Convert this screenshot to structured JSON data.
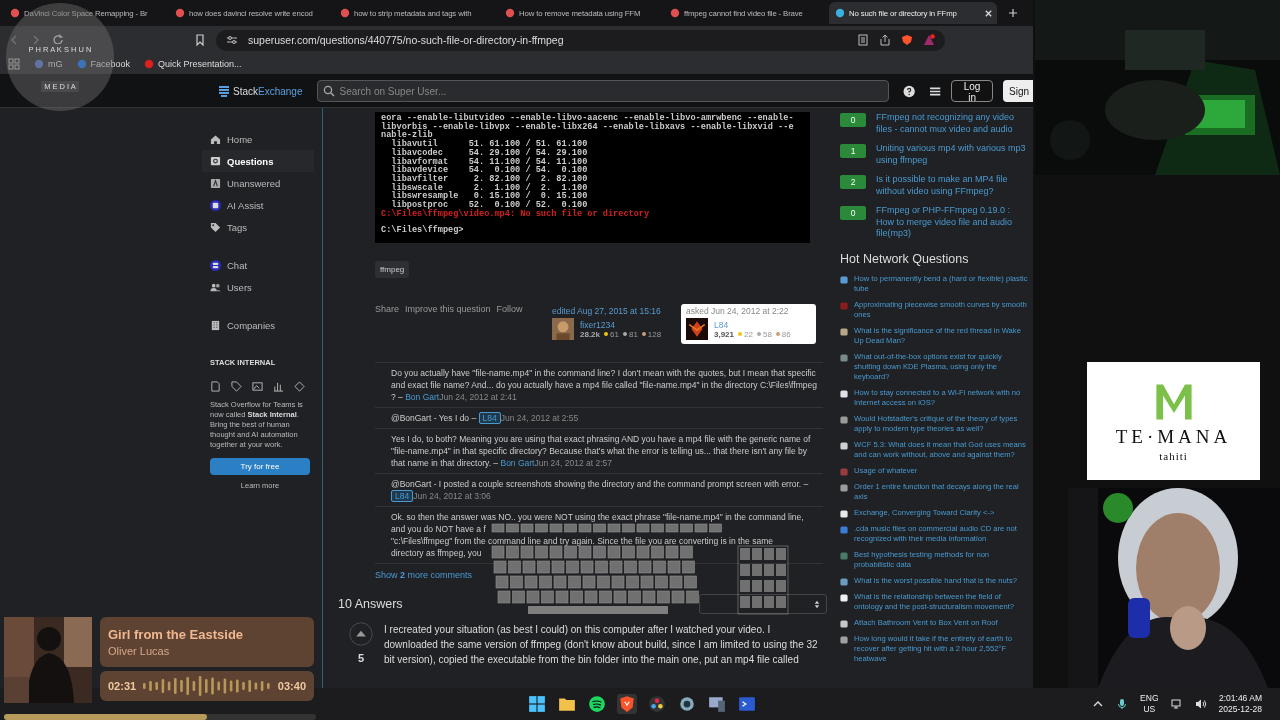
{
  "browser": {
    "tabs": [
      {
        "title": "DaVinci Color Space Remapping - Br",
        "selected": false
      },
      {
        "title": "how does davinci resolve write encod",
        "selected": false
      },
      {
        "title": "how to strip metadata and tags with",
        "selected": false
      },
      {
        "title": "How to remove metadata using FFM",
        "selected": false
      },
      {
        "title": "ffmpeg cannot find video file - Brave",
        "selected": false
      },
      {
        "title": "No such file or directory in FFmp",
        "selected": true
      }
    ],
    "address": "superuser.com/questions/440775/no-such-file-or-directory-in-ffmpeg",
    "bookmarks": [
      "mG",
      "Facebook",
      "Quick Presentation..."
    ]
  },
  "stream_logo": {
    "top": "P H R A K S H U N",
    "bottom": "M E D I A"
  },
  "site_header": {
    "logo_a": "Stack",
    "logo_b": "Exchange",
    "search_placeholder": "Search on Super User...",
    "login": "Log in",
    "signup": "Sign"
  },
  "nav": {
    "items": [
      {
        "label": "Home",
        "selected": false
      },
      {
        "label": "Questions",
        "selected": true
      },
      {
        "label": "Unanswered",
        "selected": false
      },
      {
        "label": "AI Assist",
        "selected": false
      },
      {
        "label": "Tags",
        "selected": false
      },
      {
        "label": "Chat",
        "selected": false
      },
      {
        "label": "Users",
        "selected": false
      },
      {
        "label": "Companies",
        "selected": false
      }
    ],
    "section_title": "STACK INTERNAL",
    "promo": "Stack Overflow for Teams is now called **Stack Internal**. Bring the best of human thought and AI automation together at your work.",
    "try_button": "Try for free",
    "learn_more": "Learn more"
  },
  "question": {
    "terminal": [
      {
        "kind": "normal",
        "text": "eora --enable-libutvideo --enable-libvo-aacenc --enable-libvo-amrwbenc --enable-"
      },
      {
        "kind": "normal",
        "text": "libvorbis --enable-libvpx --enable-libx264 --enable-libxavs --enable-libxvid --e"
      },
      {
        "kind": "normal",
        "text": "nable-zlib"
      },
      {
        "kind": "normal",
        "text": "  libavutil      51. 61.100 / 51. 61.100"
      },
      {
        "kind": "normal",
        "text": "  libavcodec     54. 29.100 / 54. 29.100"
      },
      {
        "kind": "normal",
        "text": "  libavformat    54. 11.100 / 54. 11.100"
      },
      {
        "kind": "normal",
        "text": "  libavdevice    54.  0.100 / 54.  0.100"
      },
      {
        "kind": "normal",
        "text": "  libavfilter     2. 82.100 /  2. 82.100"
      },
      {
        "kind": "normal",
        "text": "  libswscale      2.  1.100 /  2.  1.100"
      },
      {
        "kind": "normal",
        "text": "  libswresample   0. 15.100 /  0. 15.100"
      },
      {
        "kind": "normal",
        "text": "  libpostproc    52.  0.100 / 52.  0.100"
      },
      {
        "kind": "error",
        "text": "C:\\Files\\ffmpeg\\video.mp4: No such file or directory"
      },
      {
        "kind": "prompt",
        "text": "C:\\Files\\ffmpeg>"
      }
    ],
    "tags": [
      "ffmpeg"
    ],
    "actions": [
      "Share",
      "Improve this question",
      "Follow"
    ],
    "edited": {
      "label": "edited Aug 27, 2015 at 15:16",
      "user": "fixer1234",
      "rep": "28.2k",
      "gold": "61",
      "silver": "81",
      "bronze": "128"
    },
    "asked": {
      "label": "asked Jun 24, 2012 at 2:22",
      "user": "L84",
      "rep": "3,921",
      "gold": "22",
      "silver": "58",
      "bronze": "86"
    }
  },
  "comments": [
    {
      "lines": [
        "Do you actually have \"file-name.mp4\" in the command line? I don't mean with the quotes, but I mean that specific and exact file name? And... do you actually have a mp4 file called \"file-name.mp4\" in the directory C:\\Files\\ffmpeg ? –"
      ],
      "user": "Bon Gart",
      "op": false,
      "date": "Jun 24, 2012 at 2:41"
    },
    {
      "lines": [
        "@BonGart - Yes I do –"
      ],
      "user": "L84",
      "op": true,
      "date": "Jun 24, 2012 at 2:55"
    },
    {
      "lines": [
        "Yes I do, to both? Meaning you are using that exact phrasing AND you have a mp4 file with the generic name of \"file-name.mp4\" in that specific directory? Because that's what the error is telling us... that there isn't any file by that name in that directory. –"
      ],
      "user": "Bon Gart",
      "op": false,
      "date": "Jun 24, 2012 at 2:57"
    },
    {
      "lines": [
        "@BonGart - I posted a couple screenshots showing the directory and the command prompt screen with error. –"
      ],
      "user": "L84",
      "op": true,
      "date": "Jun 24, 2012 at 3:06"
    },
    {
      "lines": [
        "Ok. so then the answer was NO.. you were NOT using the exact phrase \"file-name.mp4\" in the command line,",
        "and you do NOT have a f",
        "\"c:\\Files\\ffmpeg\" from the command line and try again. Since the file you are converting is in the same",
        "directory as ffmpeg, you"
      ]
    }
  ],
  "show_more": "Show **2** more comments",
  "answers": {
    "title": "10 Answers",
    "score": "5",
    "text": "I recreated your situation (as best I could) on this computer after I watched your video. I downloaded the same version of ffmpeg (don't know about build, since I am limited to using the 32 bit version), copied the executable from the bin folder into the main one, put an mp4 file called"
  },
  "related": [
    {
      "score": "0",
      "title": "FFmpeg not recognizing any video files - cannot mux video and audio"
    },
    {
      "score": "1",
      "title": "Uniting various mp4 with various mp3 using ffmpeg"
    },
    {
      "score": "2",
      "title": "Is it possible to make an MP4 file without video using FFmpeg?"
    },
    {
      "score": "0",
      "title": "FFmpeg or PHP-FFmpeg 0.19.0 : How to merge video file and audio file(mp3)"
    }
  ],
  "hot_title": "Hot Network Questions",
  "hot": [
    {
      "title": "How to permanently bend a (hard or flexible) plastic tube",
      "color": "#5b9bd5"
    },
    {
      "title": "Approximating piecewise smooth curves by smooth ones",
      "color": "#8b1c1c"
    },
    {
      "title": "What is the significance of the red thread in Wake Up Dead Man?",
      "color": "#b8a88a"
    },
    {
      "title": "What out-of-the-box options exist for quickly shutting down KDE Plasma, using only the keyboard?",
      "color": "#7a8a8a"
    },
    {
      "title": "How to stay connected to a Wi-Fi network with no Internet access on iOS?",
      "color": "#dde3e8"
    },
    {
      "title": "Would Hofstadter's critique of the theory of types apply to modern type theories as well?",
      "color": "#9a9a9a"
    },
    {
      "title": "WCF 5.3: What does it mean that God uses means and can work without, above and against them?",
      "color": "#d0d0d0"
    },
    {
      "title": "Usage of whatever",
      "color": "#9c3b3b"
    },
    {
      "title": "Order 1 entire function that decays along the real axis",
      "color": "#9b9b9b"
    },
    {
      "title": "Exchange, Converging Toward Clarity <->",
      "color": "#e8e8e8"
    },
    {
      "title": ".cda music files on commercial audio CD are not recognized with their media information",
      "color": "#3a7bd5"
    },
    {
      "title": "Best hypothesis testing methods for non probabilistic data",
      "color": "#4a7a6a"
    },
    {
      "title": "What is the worst possible hand that is the nuts?",
      "color": "#6a9bc0"
    },
    {
      "title": "What is the relationship between the field of ontology and the post-structuralism movement?",
      "color": "#f0f0f0"
    },
    {
      "title": "Attach Bathroom Vent to Box Vent on Roof",
      "color": "#c8c8c8"
    },
    {
      "title": "How long would it take if the entirety of earth to recover after getting hit with a 2 hour 2,552°F heatwave",
      "color": "#a0a0a0"
    }
  ],
  "sponsor": {
    "name": "TE·MANA",
    "sub": "tahiti"
  },
  "music": {
    "title": "Girl from the Eastside",
    "artist": "Oliver Lucas",
    "elapsed": "02:31",
    "total": "03:40",
    "level": 0.65
  },
  "tray": {
    "lang": "ENG",
    "region": "US",
    "time": "2:01:46 AM",
    "date": "2025-12-28"
  }
}
